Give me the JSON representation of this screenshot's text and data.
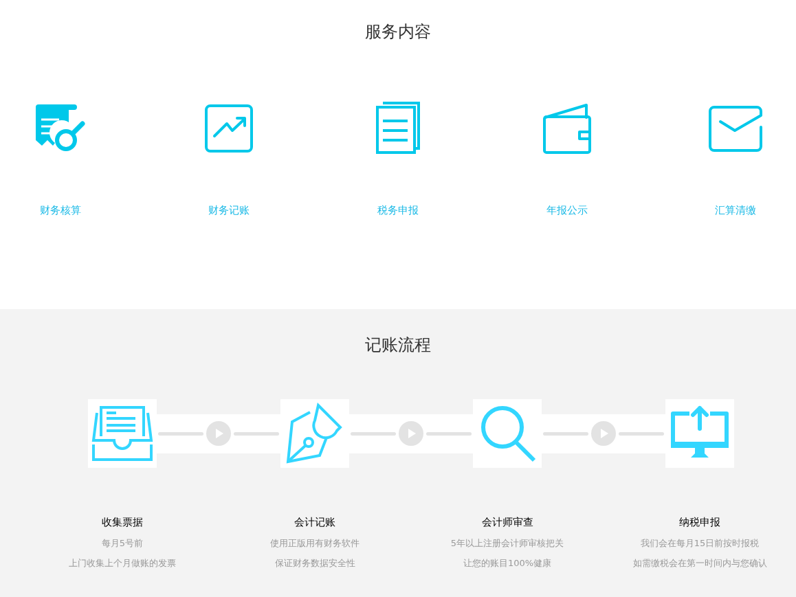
{
  "services": {
    "title": "服务内容",
    "items": [
      {
        "label": "财务核算"
      },
      {
        "label": "财务记账"
      },
      {
        "label": "税务申报"
      },
      {
        "label": "年报公示"
      },
      {
        "label": "汇算清缴"
      }
    ]
  },
  "process": {
    "title": "记账流程",
    "steps": [
      {
        "title": "收集票据",
        "lines": [
          "每月5号前",
          "上门收集上个月做账的发票"
        ]
      },
      {
        "title": "会计记账",
        "lines": [
          "使用正版用有财务软件",
          "保证财务数据安全性"
        ]
      },
      {
        "title": "会计师审查",
        "lines": [
          "5年以上注册会计师审核把关",
          "让您的账目100%健康"
        ]
      },
      {
        "title": "纳税申报",
        "lines": [
          "我们会在每月15日前按时报税",
          "如需缴税会在第一时间内与您确认"
        ]
      }
    ]
  }
}
